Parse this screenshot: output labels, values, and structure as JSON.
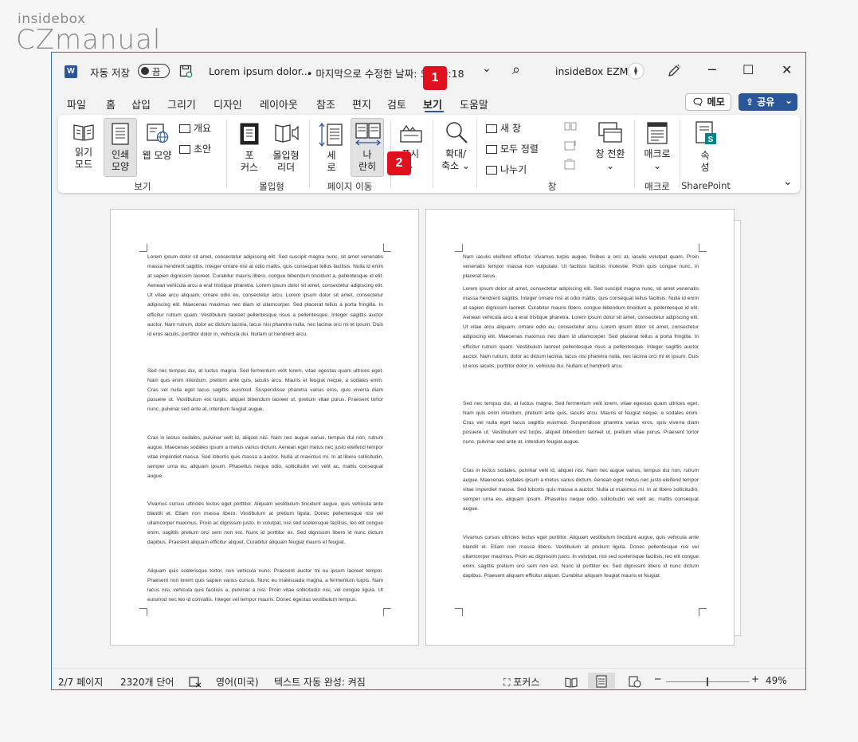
{
  "watermark": {
    "line1": "insidebox",
    "line2": "CZmanual"
  },
  "titlebar": {
    "app_icon": "W",
    "autosave_label": "자동 저장",
    "autosave_state": "끔",
    "doc_title": "Lorem ipsum dolor...",
    "last_modified": "• 마지막으로 수정한 날짜: 오후 9:18",
    "chevron": "⌄",
    "search_icon": "⌕",
    "user": "insideBox EZM",
    "minimize": "─",
    "maximize": "☐",
    "close": "✕"
  },
  "badges": {
    "b1": "1",
    "b2": "2"
  },
  "tabs": [
    "파일",
    "홈",
    "삽입",
    "그리기",
    "디자인",
    "레이아웃",
    "참조",
    "편지",
    "검토",
    "보기",
    "도움말"
  ],
  "active_tab": "보기",
  "memo_label": "메모",
  "share_label": "공유",
  "share_chevron": "⌄",
  "ribbon": {
    "read_mode": [
      "읽기",
      "모드"
    ],
    "print_layout": [
      "인쇄",
      "모양"
    ],
    "web_layout": "웹 모양",
    "outline": "개요",
    "draft": "초안",
    "group_view": "보기",
    "focus": [
      "포",
      "커스"
    ],
    "immersive_reader": [
      "몰입형",
      "리더"
    ],
    "group_immersive": "몰입형",
    "vertical": [
      "세",
      "로"
    ],
    "side_by_side": [
      "나",
      "란히"
    ],
    "group_page_move": "페이지 이동",
    "show": [
      "표시",
      "⌄"
    ],
    "zoom": [
      "확대/",
      "축소 ⌄"
    ],
    "new_window": "새 창",
    "arrange_all": "모두 정렬",
    "split": "나누기",
    "switch_window": [
      "창 전환",
      "⌄"
    ],
    "group_window": "창",
    "macros": [
      "매크로",
      "⌄"
    ],
    "group_macros": "매크로",
    "properties": [
      "속",
      "성"
    ],
    "group_sharepoint": "SharePoint",
    "collapse": "⌄"
  },
  "pages": {
    "left": [
      "Lorem ipsum dolor sit amet, consectetur adipiscing elit. Sed suscipit magna nunc, sit amet venenatis massa hendrerit sagittis. Integer ornare nisi at odio mattis, quis consequat tellus facilisis. Nulla id enim at sapien dignissim laoreet. Curabitur mauris libero, congue bibendum tincidunt a, pellentesque id elit. Aenean vehicula arcu a erat tristique pharetra. Lorem ipsum dolor sit amet, consectetur adipiscing elit. Ut vitae arcu aliquam, ornare odio eu, consectetur arcu. Lorem ipsum dolor sit amet, consectetur adipiscing elit. Maecenas maximus nec diam id ullamcorper. Sed placerat tellus a porta fringilla. In efficitur rutrum quam. Vestibulum laoreet pellentesque risus a pellentesque. Integer sagittis auctor auctor. Nam rutrum, dolor ac dictum lacinia, lacus nisi pharetra nulla, nec lacinia orci mi et ipsum. Duis id eros iaculis, porttitor dolor in, vehicula dui. Nullam ut hendrerit arcu.",
      "Sed nec tempus dui, at luctus magna. Sed fermentum velit lorem, vitae egestas quam ultrices eget. Nam quis enim interdum, pretium ante quis, iaculis arcu. Mauris et feugiat neque, a sodales enim. Cras vel nulla eget lacus sagittis euismod. Suspendisse pharetra varius eros, quis viverra diam posuere ut. Vestibulum est turpis, aliquet bibendum laoreet ut, pretium vitae purus. Praesent tortor nunc, pulvinar sed ante at, interdum feugiat augue.",
      "Cras in lectus sodales, pulvinar velit id, aliquet nisi. Nam nec augue varius, tempus dui non, rutrum augue. Maecenas sodales ipsum a metus varius dictum. Aenean eget metus nec justo eleifend tempor vitae imperdiet massa. Sed lobortis quis massa a auctor. Nulla ut maximus mi. In at libero sollicitudin, semper urna eu, aliquam ipsum. Phasellus neque odio, sollicitudin vel velit ac, mattis consequat augue.",
      "Vivamus cursus ultricies lectus eget porttitor. Aliquam vestibulum tincidunt augue, quis vehicula ante blandit et. Etiam non massa libero. Vestibulum at pretium ligula. Donec pellentesque nisi vel ullamcorper maximus. Proin ac dignissim justo. In volutpat, nisl sed scelerisque facilisis, leo elit congue enim, sagittis pretium orci sem non est. Nunc id porttitor ex. Sed dignissim libero id nunc dictum dapibus. Praesent aliquam efficitur aliquet. Curabitur aliquam feugiat mauris et feugiat.",
      "Aliquam quis scelerisque tortor, non vehicula nunc. Praesent auctor mi eu ipsum laoreet tempor. Praesent non lorem quis sapien varius cursus. Nunc eu malesuada magna, a fermentum turpis. Nam lacus nisi, vehicula quis facilisis a, pulvinar a nisl. Proin vitae sollicitudin nisi, vel congue ligula. Ut euismod nec leo id convallis. Integer vel tempor mauris. Donec egestas vestibulum tempus."
    ],
    "right": [
      "Nam iaculis eleifend efficitur. Vivamus turpis augue, finibus a orci at, iaculis volutpat quam. Proin venenatis tempor massa non vulputate. Ut facilisis facilisis molestie. Proin quis congue nunc, in placerat lacus.",
      "Lorem ipsum dolor sit amet, consectetur adipiscing elit. Sed suscipit magna nunc, sit amet venenatis massa hendrerit sagittis. Integer ornare nisi at odio mattis, quis consequat tellus facilisis. Nulla id enim at sapien dignissim laoreet. Curabitur mauris libero, congue bibendum tincidunt a, pellentesque id elit. Aenean vehicula arcu a erat tristique pharetra. Lorem ipsum dolor sit amet, consectetur adipiscing elit. Ut vitae arcu aliquam, ornare odio eu, consectetur arcu. Lorem ipsum dolor sit amet, consectetur adipiscing elit. Maecenas maximus nec diam id ullamcorper. Sed placerat tellus a porta fringilla. In efficitur rutrum quam. Vestibulum laoreet pellentesque risus a pellentesque. Integer sagittis auctor auctor. Nam rutrum, dolor ac dictum lacinia, lacus nisi pharetra nulla, nec lacinia orci mi et ipsum. Duis id eros iaculis, porttitor dolor in, vehicula dui. Nullam ut hendrerit arcu.",
      "Sed nec tempus dui, at luctus magna. Sed fermentum velit lorem, vitae egestas quam ultrices eget. Nam quis enim interdum, pretium ante quis, iaculis arcu. Mauris et feugiat neque, a sodales enim. Cras vel nulla eget lacus sagittis euismod. Suspendisse pharetra varius eros, quis viverra diam posuere ut. Vestibulum est turpis, aliquet bibendum laoreet ut, pretium vitae purus. Praesent tortor nunc, pulvinar sed ante at, interdum feugiat augue.",
      "Cras in lectus sodales, pulvinar velit id, aliquet nisi. Nam nec augue varius, tempus dui non, rutrum augue. Maecenas sodales ipsum a metus varius dictum. Aenean eget metus nec justo eleifend tempor vitae imperdiet massa. Sed lobortis quis massa a auctor. Nulla ut maximus mi. In at libero sollicitudin, semper urna eu, aliquam ipsum. Phasellus neque odio, sollicitudin vel velit ac, mattis consequat augue.",
      "Vivamus cursus ultricies lectus eget porttitor. Aliquam vestibulum tincidunt augue, quis vehicula ante blandit et. Etiam non massa libero. Vestibulum at pretium ligula. Donec pellentesque nisi vel ullamcorper maximus. Proin ac dignissim justo. In volutpat, nisl sed scelerisque facilisis, leo elit congue enim, sagittis pretium orci sem non est. Nunc id porttitor ex. Sed dignissim libero id nunc dictum dapibus. Praesent aliquam efficitur aliquet. Curabitur aliquam feugiat mauris et feugiat."
    ]
  },
  "statusbar": {
    "page": "2/7 페이지",
    "words": "2320개 단어",
    "language": "영어(미국)",
    "autocomplete": "텍스트 자동 완성: 켜짐",
    "focus": "포커스",
    "zoom_minus": "─",
    "zoom_plus": "+",
    "zoom": "49%"
  }
}
